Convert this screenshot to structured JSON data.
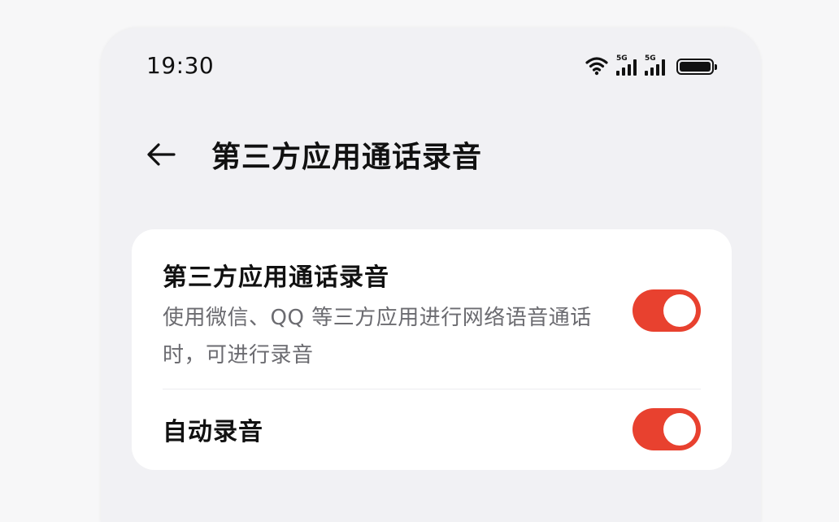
{
  "status_bar": {
    "time": "19:30",
    "icons": [
      "wifi-icon",
      "signal-5g-icon",
      "signal-5g-icon",
      "battery-icon"
    ],
    "network_tag": "5G"
  },
  "header": {
    "back_icon": "arrow-left-icon",
    "title": "第三方应用通话录音"
  },
  "settings": [
    {
      "title": "第三方应用通话录音",
      "description": "使用微信、QQ 等三方应用进行网络语音通话时，可进行录音",
      "enabled": true
    },
    {
      "title": "自动录音",
      "enabled": true
    }
  ],
  "colors": {
    "accent": "#e8412f",
    "background": "#f1f1f4",
    "card": "#ffffff",
    "text_primary": "#111111",
    "text_secondary": "#6b6b70"
  }
}
